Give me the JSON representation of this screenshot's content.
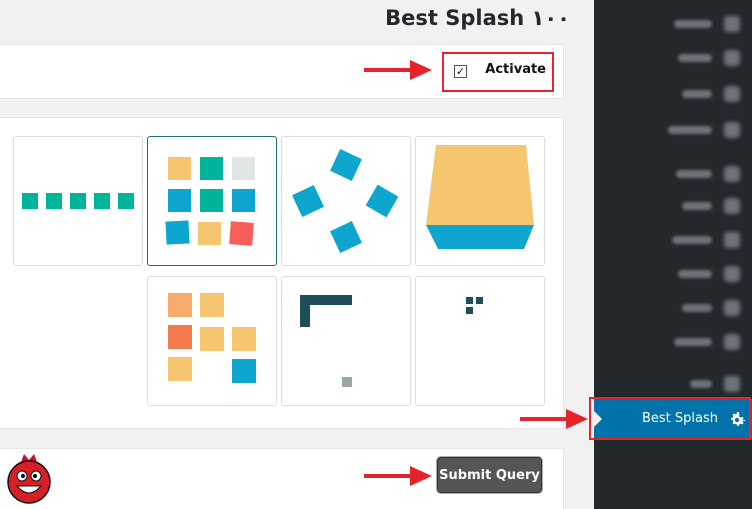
{
  "header": {
    "title": "Best Splash ۱۰۰"
  },
  "settings": {
    "activate_label": "Activate",
    "activate_checked": true
  },
  "form": {
    "submit_label": "Submit Query"
  },
  "sidebar": {
    "active_label": "Best Splash",
    "active_icon": "gear-icon"
  },
  "colors": {
    "teal": "#00b39b",
    "blue": "#0ea5cf",
    "yellow": "#f5c66f",
    "orange": "#f9ab6b",
    "red": "#f75d59",
    "grey": "#e0e6e6",
    "dark": "#1f4e5a",
    "accent": "#0073aa",
    "arrow": "#e3242b"
  }
}
